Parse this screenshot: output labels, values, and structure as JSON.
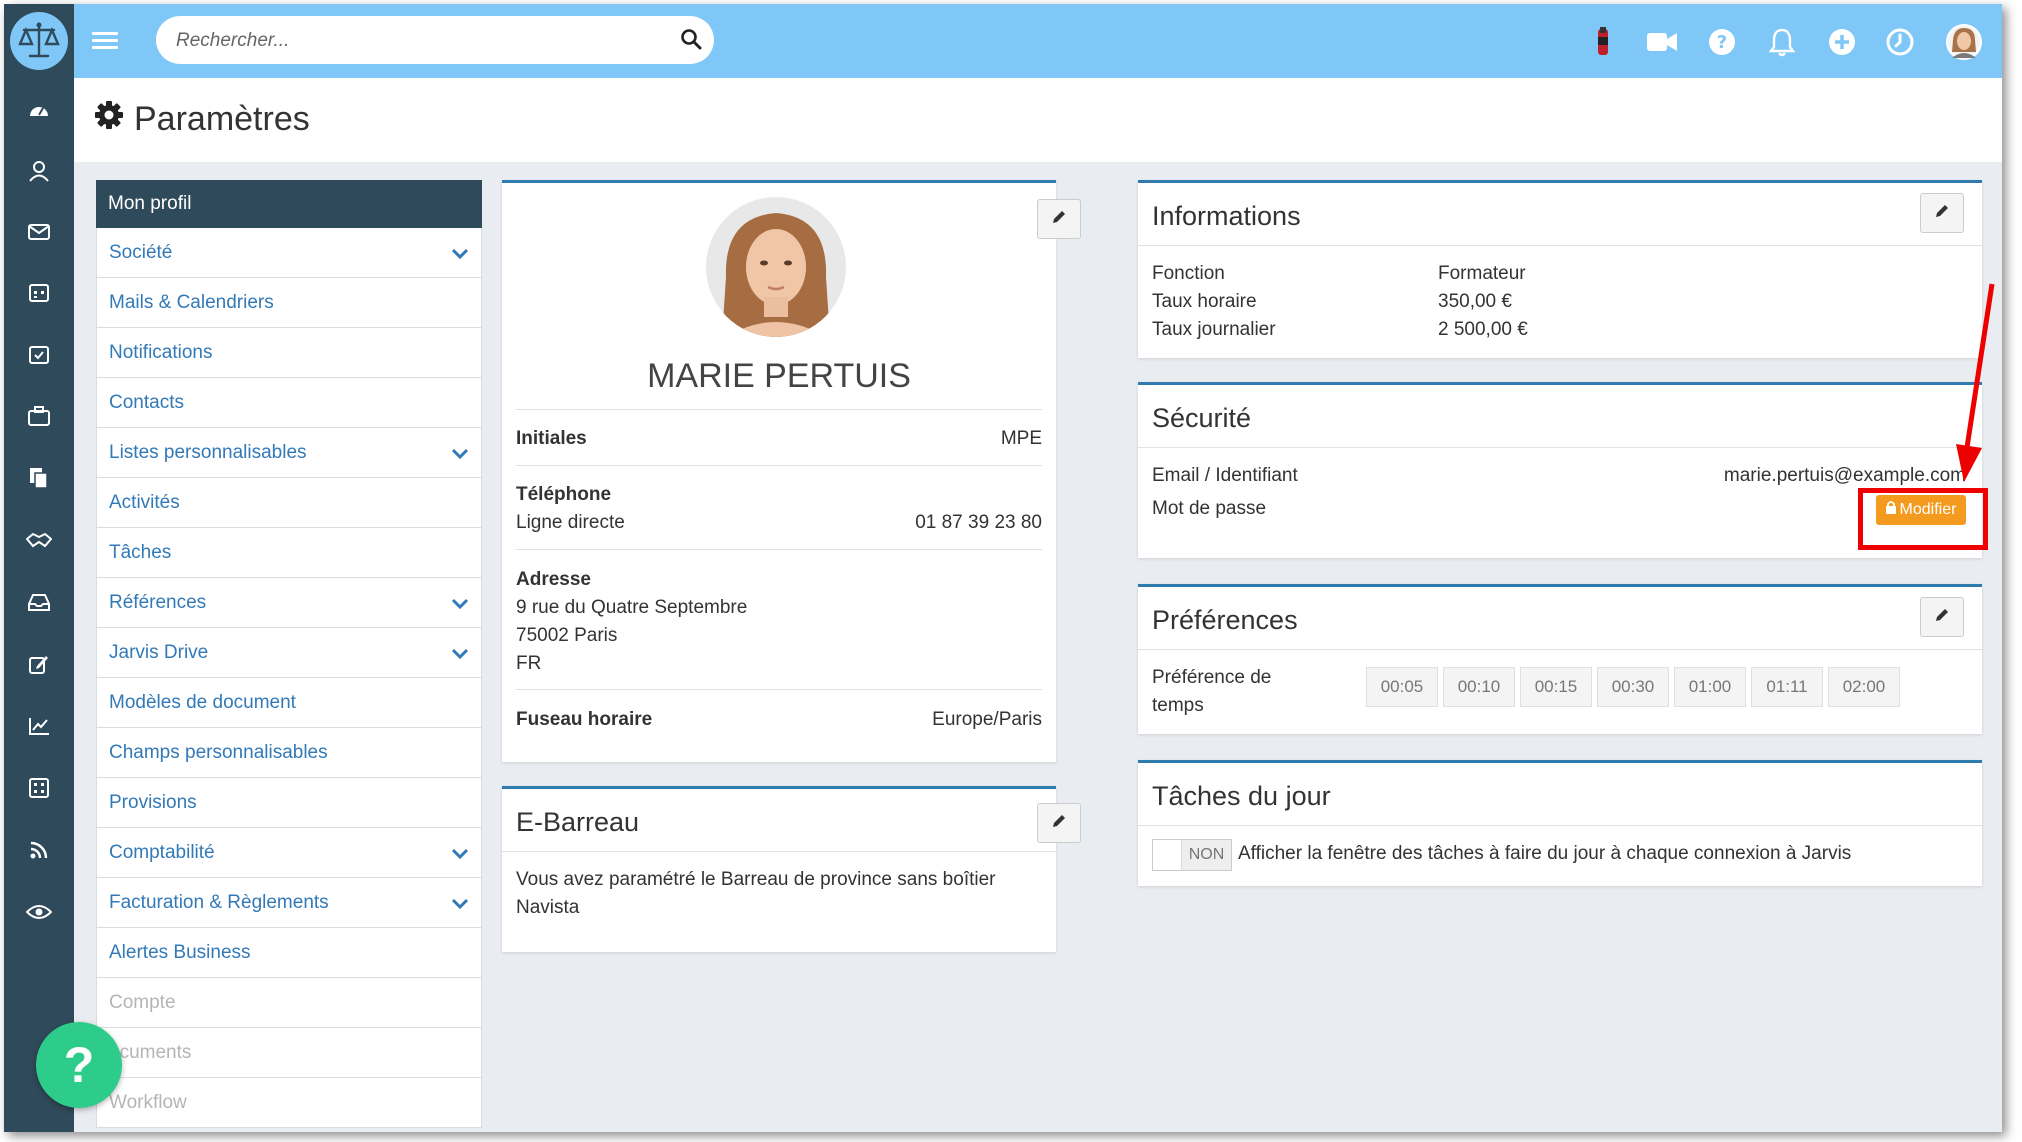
{
  "search": {
    "placeholder": "Rechercher..."
  },
  "page": {
    "title": "Paramètres"
  },
  "menu": {
    "header": "Mon profil",
    "items": [
      {
        "label": "Société",
        "expandable": true,
        "disabled": false
      },
      {
        "label": "Mails & Calendriers",
        "expandable": false,
        "disabled": false
      },
      {
        "label": "Notifications",
        "expandable": false,
        "disabled": false
      },
      {
        "label": "Contacts",
        "expandable": false,
        "disabled": false
      },
      {
        "label": "Listes personnalisables",
        "expandable": true,
        "disabled": false
      },
      {
        "label": "Activités",
        "expandable": false,
        "disabled": false
      },
      {
        "label": "Tâches",
        "expandable": false,
        "disabled": false
      },
      {
        "label": "Références",
        "expandable": true,
        "disabled": false
      },
      {
        "label": "Jarvis Drive",
        "expandable": true,
        "disabled": false
      },
      {
        "label": "Modèles de document",
        "expandable": false,
        "disabled": false
      },
      {
        "label": "Champs personnalisables",
        "expandable": false,
        "disabled": false
      },
      {
        "label": "Provisions",
        "expandable": false,
        "disabled": false
      },
      {
        "label": "Comptabilité",
        "expandable": true,
        "disabled": false
      },
      {
        "label": "Facturation & Règlements",
        "expandable": true,
        "disabled": false
      },
      {
        "label": "Alertes Business",
        "expandable": false,
        "disabled": false
      },
      {
        "label": "Compte",
        "expandable": false,
        "disabled": true
      },
      {
        "label": "ocuments",
        "expandable": false,
        "disabled": true
      },
      {
        "label": "Workflow",
        "expandable": false,
        "disabled": true
      }
    ]
  },
  "profile": {
    "name": "MARIE PERTUIS",
    "initiales_label": "Initiales",
    "initiales_value": "MPE",
    "telephone_label": "Téléphone",
    "ligne_label": "Ligne directe",
    "ligne_value": "01 87 39 23 80",
    "adresse_label": "Adresse",
    "adresse_line1": "9 rue du Quatre Septembre",
    "adresse_line2": "75002 Paris",
    "adresse_line3": "FR",
    "fuseau_label": "Fuseau horaire",
    "fuseau_value": "Europe/Paris"
  },
  "ebarreau": {
    "title": "E-Barreau",
    "text_line1": "Vous avez paramétré le Barreau de province sans boîtier",
    "text_line2": "Navista"
  },
  "informations": {
    "title": "Informations",
    "rows": [
      {
        "label": "Fonction",
        "value": "Formateur"
      },
      {
        "label": "Taux horaire",
        "value": "350,00 €"
      },
      {
        "label": "Taux journalier",
        "value": "2 500,00 €"
      }
    ]
  },
  "securite": {
    "title": "Sécurité",
    "email_label": "Email / Identifiant",
    "email_value": "marie.pertuis@example.com",
    "password_label": "Mot de passe",
    "modifier_label": "Modifier"
  },
  "preferences": {
    "title": "Préférences",
    "label_line1": "Préférence de",
    "label_line2": "temps",
    "times": [
      "00:05",
      "00:10",
      "00:15",
      "00:30",
      "01:00",
      "01:11",
      "02:00"
    ]
  },
  "taches_jour": {
    "title": "Tâches du jour",
    "toggle_label": "NON",
    "text": "Afficher la fenêtre des tâches à faire du jour à chaque connexion à Jarvis"
  },
  "help": {
    "label": "?"
  },
  "colors": {
    "topbar": "#7fc7f7",
    "sidebar": "#2f4a5a",
    "link": "#3279b7",
    "card_accent": "#2f7bb0",
    "modifier": "#f49b1f",
    "highlight": "#ee0000",
    "help": "#2ecc8a"
  }
}
